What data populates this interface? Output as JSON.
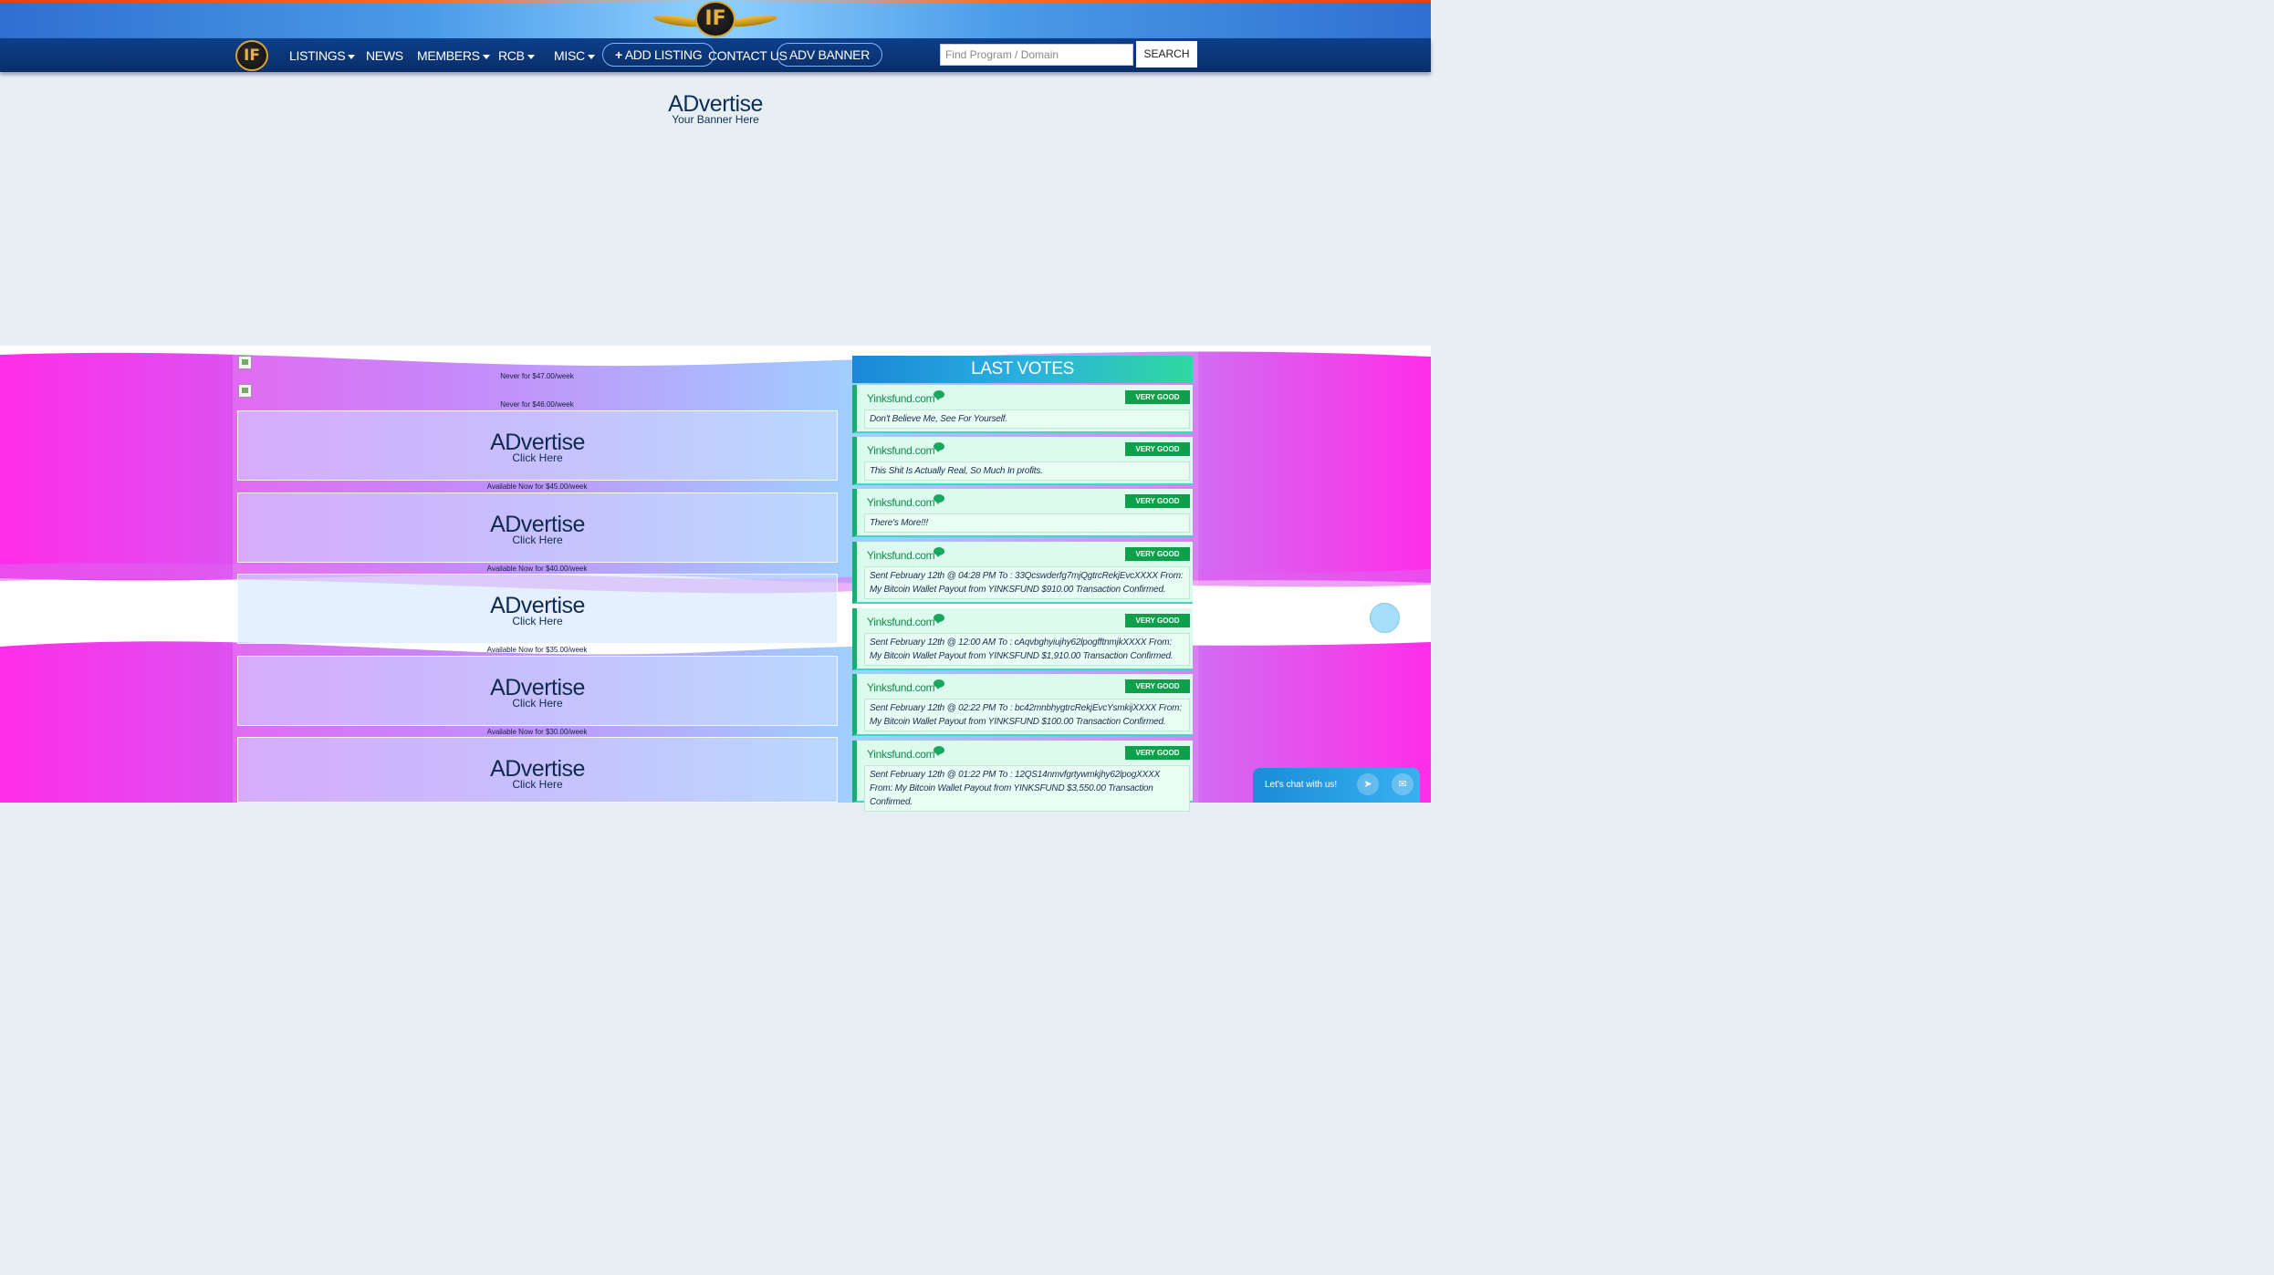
{
  "header": {
    "logo_text": "IF"
  },
  "nav": {
    "logo_text": "IF",
    "items": [
      {
        "label": "LISTINGS",
        "dropdown": true
      },
      {
        "label": "NEWS",
        "dropdown": false
      },
      {
        "label": "MEMBERS",
        "dropdown": true
      },
      {
        "label": "RCB",
        "dropdown": true
      },
      {
        "label": "MISC",
        "dropdown": true
      }
    ],
    "add_listing": "ADD LISTING",
    "contact": "CONTACT US",
    "adv_banner": "ADV BANNER",
    "search_placeholder": "Find Program / Domain",
    "search_button": "SEARCH"
  },
  "banner": {
    "title": "ADvertise",
    "subtitle": "Your Banner Here"
  },
  "ads": {
    "small": [
      {
        "caption": "Never for $47.00/week"
      },
      {
        "caption": "Never for $46.00/week"
      }
    ],
    "slots": [
      {
        "title": "ADvertise",
        "cta": "Click Here",
        "price": "Available Now for $45.00/week"
      },
      {
        "title": "ADvertise",
        "cta": "Click Here",
        "price": "Available Now for $40.00/week"
      },
      {
        "title": "ADvertise",
        "cta": "Click Here",
        "price": "Available Now for $35.00/week"
      },
      {
        "title": "ADvertise",
        "cta": "Click Here",
        "price": "Available Now for $30.00/week"
      },
      {
        "title": "ADvertise",
        "cta": "Click Here"
      }
    ]
  },
  "votes": {
    "heading": "LAST VOTES",
    "items": [
      {
        "site": "Yinksfund.com",
        "rating": "VERY GOOD",
        "message": "Don't Believe Me, See For Yourself."
      },
      {
        "site": "Yinksfund.com",
        "rating": "VERY GOOD",
        "message": "This Shit Is Actually Real, So Much In profits."
      },
      {
        "site": "Yinksfund.com",
        "rating": "VERY GOOD",
        "message": "There's More!!!"
      },
      {
        "site": "Yinksfund.com",
        "rating": "VERY GOOD",
        "message": "Sent February 12th @ 04:28 PM To : 33Qcswderfg7mjQgtrcRekjEvcXXXX From: My Bitcoin Wallet Payout from YINKSFUND $910.00 Transaction Confirmed."
      },
      {
        "site": "Yinksfund.com",
        "rating": "VERY GOOD",
        "message": "Sent February 12th @ 12:00 AM To : cAqvbghyiujhy62lpogfftnmjkXXXX From: My Bitcoin Wallet Payout from YINKSFUND $1,910.00 Transaction Confirmed."
      },
      {
        "site": "Yinksfund.com",
        "rating": "VERY GOOD",
        "message": "Sent February 12th @ 02:22 PM To : bc42mnbhygtrcRekjEvcYsmkijXXXX From: My Bitcoin Wallet Payout from YINKSFUND $100.00 Transaction Confirmed."
      },
      {
        "site": "Yinksfund.com",
        "rating": "VERY GOOD",
        "message": "Sent February 12th @ 01:22 PM To : 12QS14nmvfgrtywmkjhy62lpogXXXX From: My Bitcoin Wallet Payout from YINKSFUND $3,550.00 Transaction Confirmed."
      }
    ]
  },
  "chat": {
    "label": "Let's chat with us!",
    "icons": [
      "telegram-icon",
      "email-icon"
    ]
  },
  "colors": {
    "nav_bg": "#0d3f8a",
    "vote_badge": "#0da04a",
    "vote_site": "#138a4e",
    "wave_magenta": "#ff2de8"
  }
}
